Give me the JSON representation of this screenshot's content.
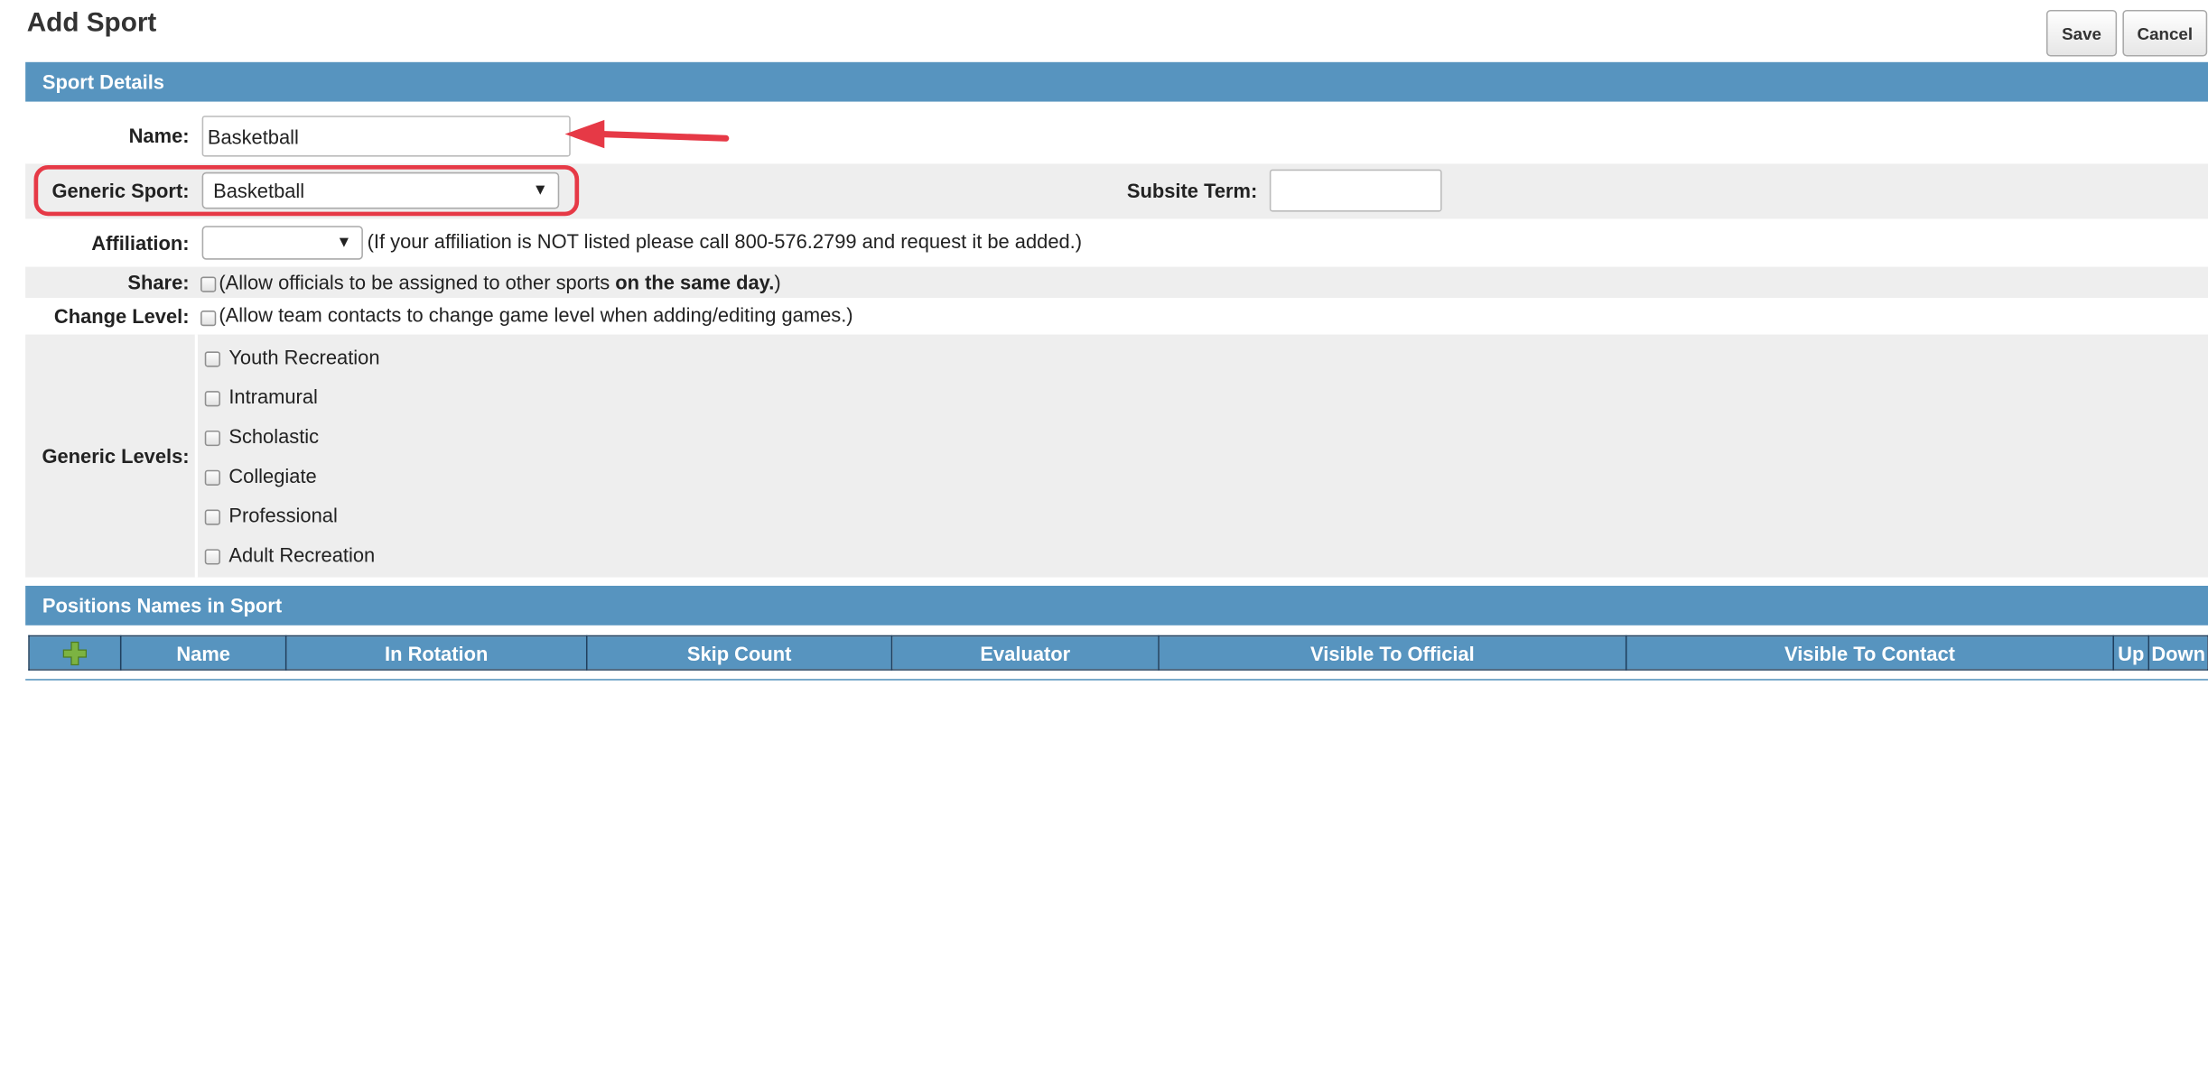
{
  "page": {
    "title": "Add Sport"
  },
  "toolbar": {
    "save_label": "Save",
    "cancel_label": "Cancel"
  },
  "sections": {
    "sport_details": "Sport Details",
    "positions": "Positions Names in Sport"
  },
  "form": {
    "name": {
      "label": "Name:",
      "value": "Basketball"
    },
    "generic_sport": {
      "label": "Generic Sport:",
      "selected": "Basketball"
    },
    "subsite_term": {
      "label": "Subsite Term:",
      "value": ""
    },
    "affiliation": {
      "label": "Affiliation:",
      "selected": "",
      "hint": "(If your affiliation is NOT listed please call 800-576.2799 and request it be added.)"
    },
    "share": {
      "label": "Share:",
      "hint_prefix": "(Allow officials to be assigned to other sports ",
      "hint_bold": "on the same day.",
      "hint_suffix": ")"
    },
    "change_level": {
      "label": "Change Level:",
      "hint": "(Allow team contacts to change game level when adding/editing games.)"
    },
    "generic_levels": {
      "label": "Generic Levels:",
      "items": [
        "Youth Recreation",
        "Intramural",
        "Scholastic",
        "Collegiate",
        "Professional",
        "Adult Recreation"
      ]
    }
  },
  "positions_table": {
    "columns": [
      "Name",
      "In Rotation",
      "Skip Count",
      "Evaluator",
      "Visible To Official",
      "Visible To Contact",
      "Up",
      "Down"
    ]
  },
  "annotations": {
    "arrow_color": "#e63946",
    "outline_color": "#e63946"
  },
  "colors": {
    "section_bar": "#5794bf",
    "shaded_row": "#eeeeee",
    "add_icon": "#7cb342"
  }
}
